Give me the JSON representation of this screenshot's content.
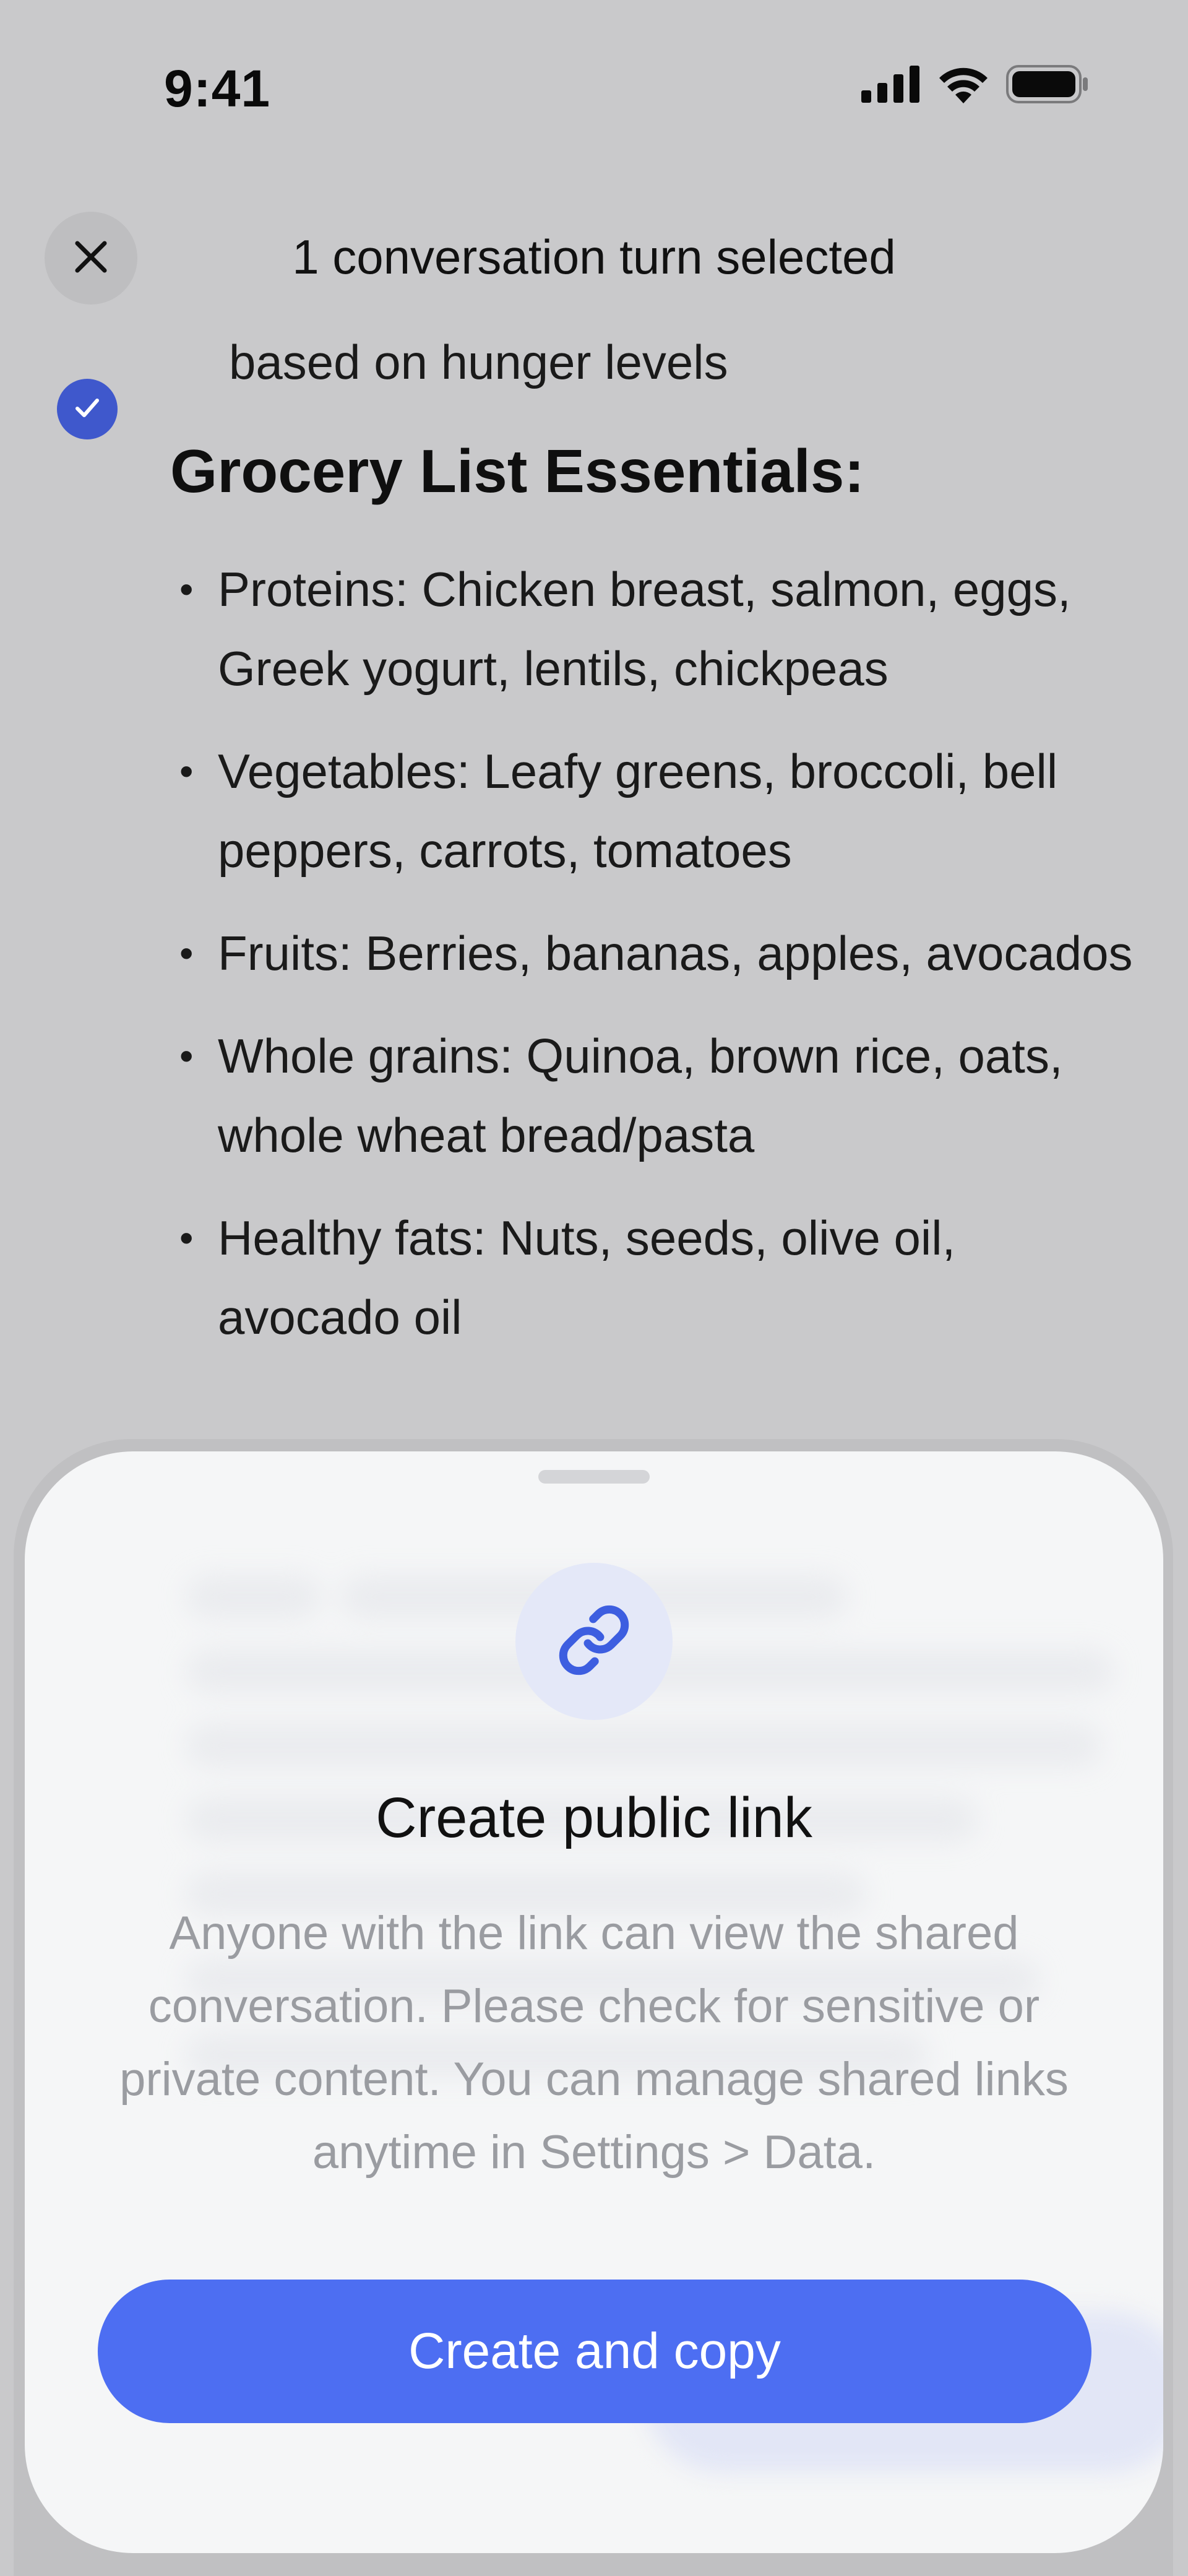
{
  "status_bar": {
    "time": "9:41"
  },
  "header": {
    "title": "1 conversation turn selected"
  },
  "message": {
    "partial_text": "based on hunger levels",
    "heading": "Grocery List Essentials:",
    "items": [
      "Proteins: Chicken breast, salmon, eggs, Greek yogurt, lentils, chickpeas",
      "Vegetables: Leafy greens, broccoli, bell peppers, carrots, tomatoes",
      "Fruits: Berries, bananas, apples, avocados",
      "Whole grains: Quinoa, brown rice, oats, whole wheat bread/pasta",
      "Healthy fats: Nuts, seeds, olive oil, avocado oil"
    ]
  },
  "share_sheet": {
    "title": "Create public link",
    "description": "Anyone with the link can view the shared conversation. Please check for sensitive or private content. You can manage shared links anytime in Settings > Data.",
    "button_label": "Create and copy"
  },
  "colors": {
    "accent": "#4d6ef2",
    "check_accent": "#3f58cc",
    "background": "#c9c9cb",
    "sheet_background": "#f5f6f7"
  },
  "icons": {
    "close": "close-icon",
    "check": "checkmark-icon",
    "link": "link-icon",
    "signal": "cellular-signal-icon",
    "wifi": "wifi-icon",
    "battery": "battery-icon"
  }
}
